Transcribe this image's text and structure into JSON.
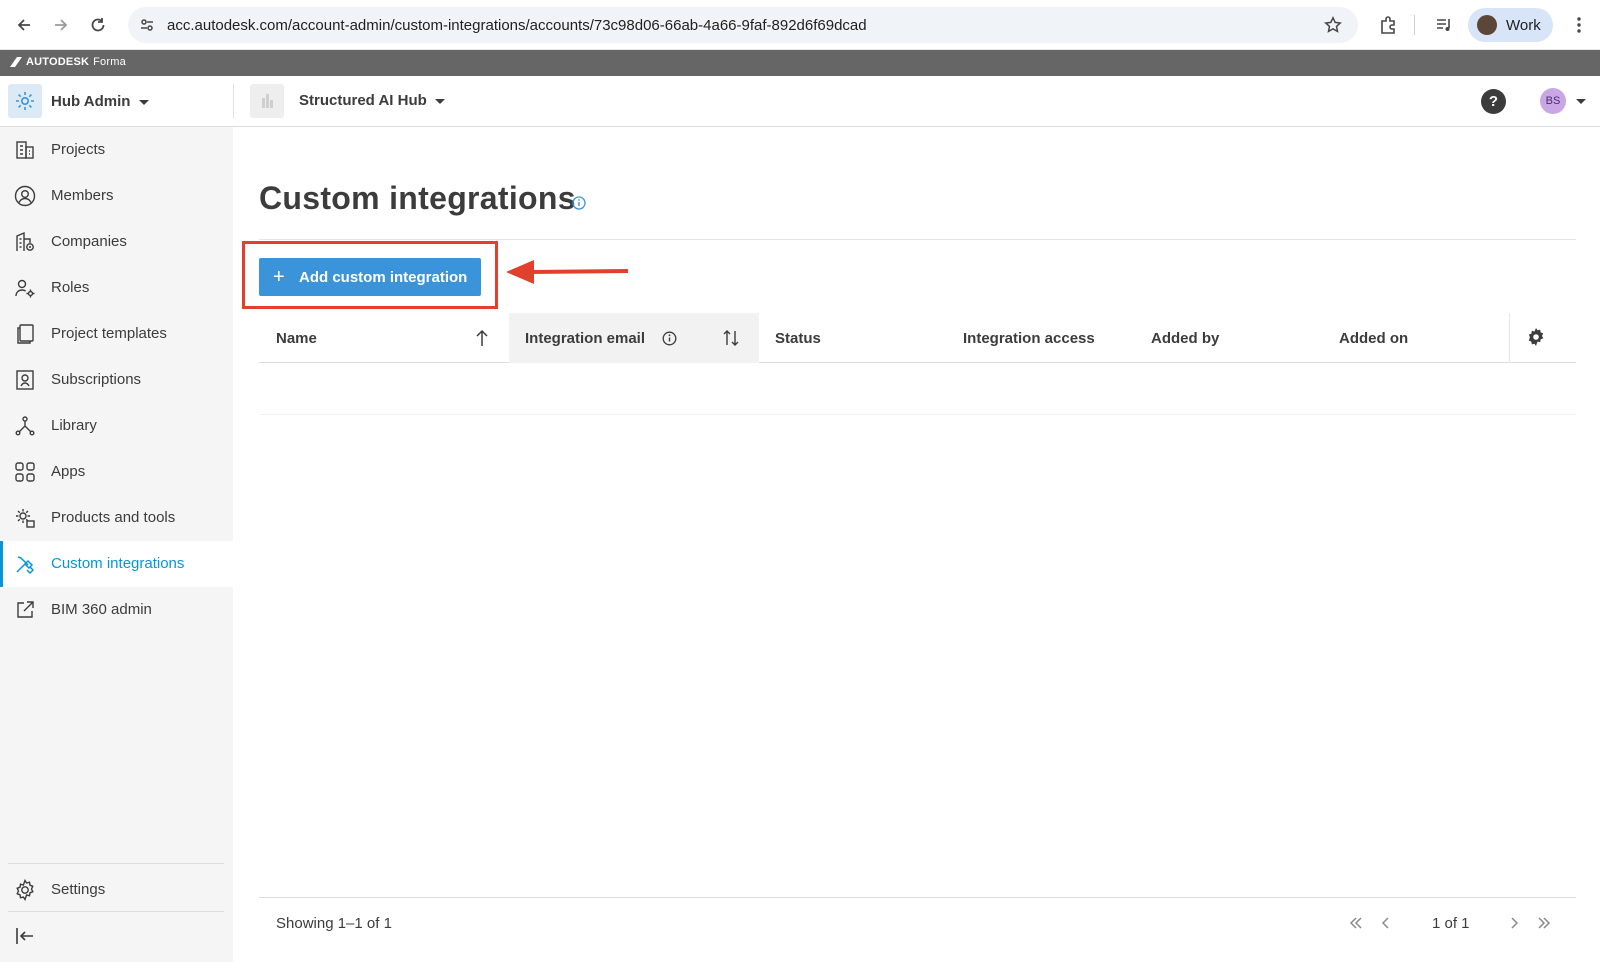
{
  "browser": {
    "url": "acc.autodesk.com/account-admin/custom-integrations/accounts/73c98d06-66ab-4a66-9faf-892d6f69dcad",
    "profile_label": "Work"
  },
  "brand": {
    "name": "AUTODESK",
    "product": "Forma"
  },
  "header": {
    "module_label": "Hub Admin",
    "hub_name": "Structured AI Hub",
    "help_label": "?",
    "avatar_initials": "BS"
  },
  "sidebar": {
    "items": [
      {
        "label": "Projects",
        "icon": "building-icon"
      },
      {
        "label": "Members",
        "icon": "user-circle-icon"
      },
      {
        "label": "Companies",
        "icon": "company-icon"
      },
      {
        "label": "Roles",
        "icon": "user-gear-icon"
      },
      {
        "label": "Project templates",
        "icon": "template-icon"
      },
      {
        "label": "Subscriptions",
        "icon": "subscription-icon"
      },
      {
        "label": "Library",
        "icon": "library-icon"
      },
      {
        "label": "Apps",
        "icon": "apps-grid-icon"
      },
      {
        "label": "Products and tools",
        "icon": "products-gear-icon"
      },
      {
        "label": "Custom integrations",
        "icon": "integration-tools-icon",
        "active": true
      },
      {
        "label": "BIM 360 admin",
        "icon": "external-link-icon"
      }
    ],
    "settings_label": "Settings"
  },
  "main": {
    "title": "Custom integrations",
    "add_button_label": "Add custom integration",
    "table": {
      "columns": [
        "Name",
        "Integration email",
        "Status",
        "Integration access",
        "Added by",
        "Added on"
      ],
      "rows": []
    },
    "footer": {
      "showing": "Showing 1–1 of 1",
      "page_label": "1 of 1"
    }
  },
  "colors": {
    "accent": "#0696d7",
    "button": "#3b94d9",
    "annotation": "#e1412c"
  }
}
